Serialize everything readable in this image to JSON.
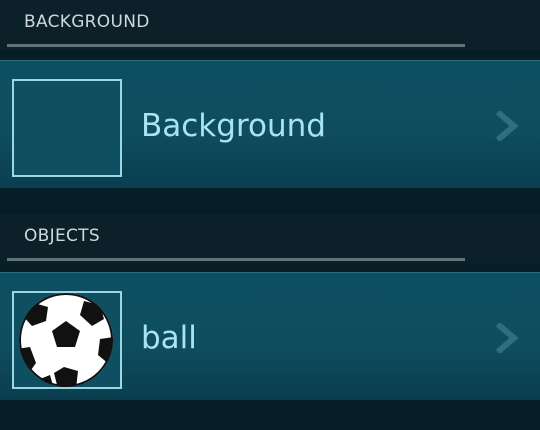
{
  "sections": [
    {
      "title": "BACKGROUND",
      "items": [
        {
          "label": "Background",
          "icon": "chevron-right-icon"
        }
      ]
    },
    {
      "title": "OBJECTS",
      "items": [
        {
          "label": "ball",
          "thumbnail": "soccer-ball-icon",
          "icon": "chevron-right-icon"
        }
      ]
    }
  ],
  "colors": {
    "background": "#071e27",
    "row": "#0d4f62",
    "label": "#a9e2f0",
    "accent_border": "#9ad6e3"
  }
}
